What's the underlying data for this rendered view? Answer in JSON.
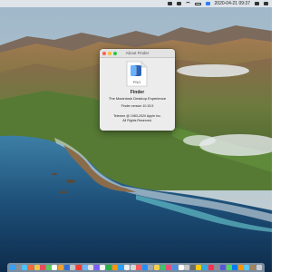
{
  "menubar": {
    "clock": "2020-04-21 09:37",
    "icons": [
      "menu-extra-icon",
      "menu-extra-icon",
      "wifi-icon",
      "battery-icon",
      "menu-extra-icon",
      "spotlight-icon",
      "control-center-icon"
    ]
  },
  "about_window": {
    "title": "About Finder",
    "file_badge": "PNG",
    "app_name": "Finder",
    "tagline": "The Macintosh Desktop Experience",
    "version": "Finder version 10.15.5",
    "copyright_line1": "Telecine @ 1983-2020 Apple Inc.",
    "copyright_line2": "All Rights Reserved."
  },
  "dock": {
    "item_colors": [
      "#3aa0f5",
      "#8a8f99",
      "#4cc2ff",
      "#f26b3a",
      "#f4c542",
      "#e84a5f",
      "#5ac85a",
      "#ffffff",
      "#f0a030",
      "#2f6fd6",
      "#c0c4cc",
      "#ff3b30",
      "#6fb6ff",
      "#e0e0e0",
      "#7a5cff",
      "#f5f5f5",
      "#25b34a",
      "#ff9500",
      "#2aa1ff",
      "#f0f0f0",
      "#d8d8d8",
      "#ff5a5a",
      "#1f8fff",
      "#9ea6b0",
      "#f6d04d",
      "#3bc66b",
      "#e94e77",
      "#4a90e2",
      "#ffffff",
      "#c8c8c8",
      "#6c6c6c",
      "#ffcc00",
      "#34aadc",
      "#ff2d55",
      "#8e8e93",
      "#5856d6",
      "#4cd964",
      "#007aff",
      "#ff9500",
      "#5ac8fa",
      "#a2845e",
      "#d0d0d0"
    ]
  }
}
